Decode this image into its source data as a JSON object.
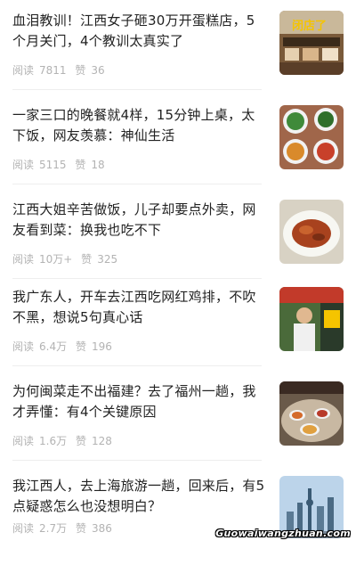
{
  "feed": {
    "items": [
      {
        "title": "血泪教训！江西女子砸30万开蛋糕店，5个月关门，4个教训太真实了",
        "reads_label": "阅读",
        "reads": "7811",
        "likes_label": "赞",
        "likes": "36",
        "thumb_text": "闭店了"
      },
      {
        "title": "一家三口的晚餐就4样，15分钟上桌，太下饭，网友羡慕：神仙生活",
        "reads_label": "阅读",
        "reads": "5115",
        "likes_label": "赞",
        "likes": "18"
      },
      {
        "title": "江西大姐辛苦做饭，儿子却要点外卖，网友看到菜：换我也吃不下",
        "reads_label": "阅读",
        "reads": "10万+",
        "likes_label": "赞",
        "likes": "325"
      },
      {
        "title": "我广东人，开车去江西吃网红鸡排，不吹不黑，想说5句真心话",
        "reads_label": "阅读",
        "reads": "6.4万",
        "likes_label": "赞",
        "likes": "196"
      },
      {
        "title": "为何闽菜走不出福建？去了福州一趟，我才弄懂：有4个关键原因",
        "reads_label": "阅读",
        "reads": "1.6万",
        "likes_label": "赞",
        "likes": "128"
      },
      {
        "title": "我江西人，去上海旅游一趟，回来后，有5点疑惑怎么也没想明白？",
        "reads_label": "阅读",
        "reads": "2.7万",
        "likes_label": "赞",
        "likes": "386"
      }
    ]
  },
  "watermark": "Guowaiwangzhuan.com"
}
